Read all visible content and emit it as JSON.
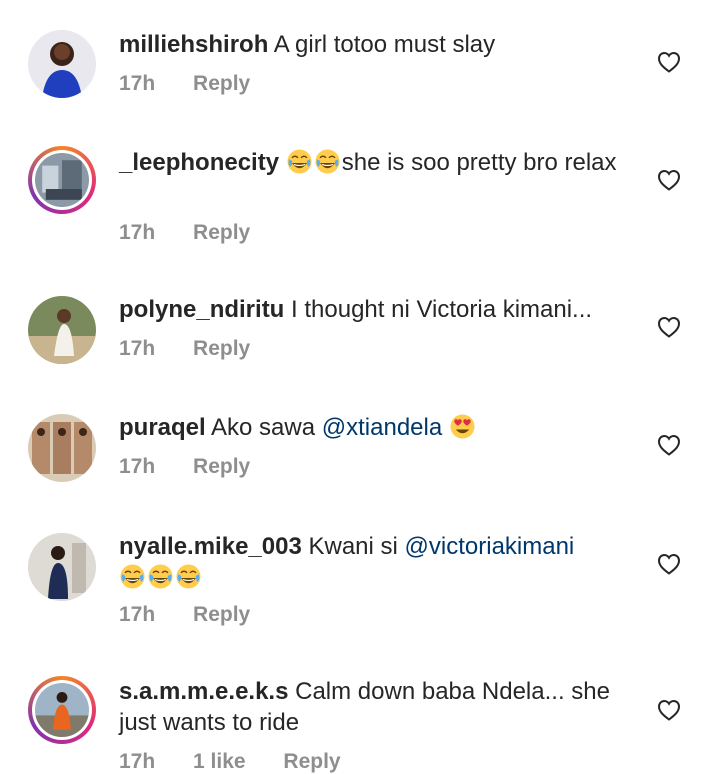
{
  "comments": [
    {
      "username": "milliehshiroh",
      "text": "A girl totoo must slay",
      "time": "17h",
      "reply": "Reply"
    },
    {
      "username": "_leephonecity",
      "emojis_before": [
        "laugh-cry",
        "laugh-cry"
      ],
      "text": "she is soo pretty bro relax",
      "time": "17h",
      "reply": "Reply"
    },
    {
      "username": "polyne_ndiritu",
      "text": "I thought ni Victoria kimani...",
      "time": "17h",
      "reply": "Reply"
    },
    {
      "username": "puraqel",
      "text": "Ako sawa",
      "mention": "@xtiandela",
      "emojis_after": [
        "heart-eyes"
      ],
      "time": "17h",
      "reply": "Reply"
    },
    {
      "username": "nyalle.mike_003",
      "text": "Kwani si",
      "mention": "@victoriakimani",
      "emojis_after": [
        "laugh-cry",
        "laugh-cry",
        "laugh-cry"
      ],
      "time": "17h",
      "reply": "Reply"
    },
    {
      "username": "s.a.m.m.e.e.k.s",
      "text": "Calm down baba Ndela... she just wants to ride",
      "time": "17h",
      "likes": "1 like",
      "reply": "Reply"
    }
  ],
  "icons": {
    "like": "heart-outline-icon"
  },
  "colors": {
    "text": "#262626",
    "meta": "#8e8e8e",
    "mention": "#00376b",
    "background": "#ffffff"
  }
}
